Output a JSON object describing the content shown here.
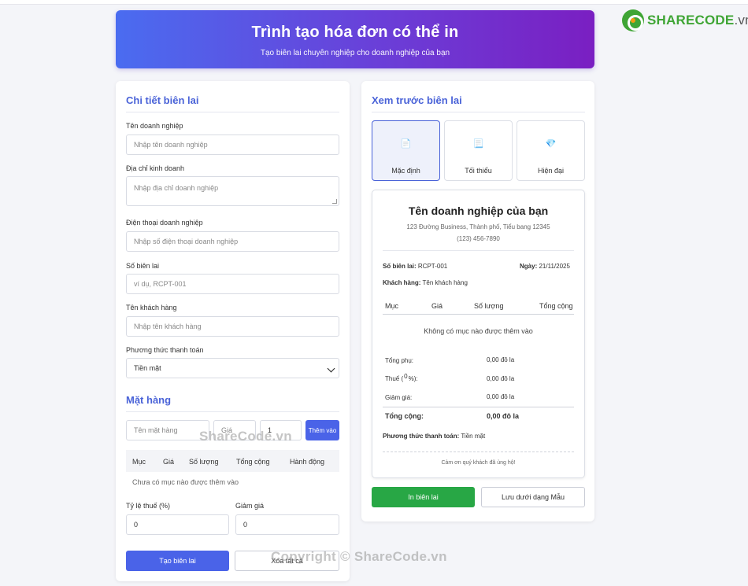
{
  "header": {
    "title": "Trình tạo hóa đơn có thể in",
    "subtitle": "Tạo biên lai chuyên nghiệp cho doanh nghiệp của bạn"
  },
  "logo": {
    "brand": "SHARECODE",
    "domain": ".vn"
  },
  "form": {
    "section_title": "Chi tiết biên lai",
    "business_name": {
      "label": "Tên doanh nghiệp",
      "placeholder": "Nhập tên doanh nghiệp"
    },
    "business_address": {
      "label": "Địa chỉ kinh doanh",
      "placeholder": "Nhập địa chỉ doanh nghiệp"
    },
    "business_phone": {
      "label": "Điện thoại doanh nghiệp",
      "placeholder": "Nhập số điện thoại doanh nghiệp"
    },
    "receipt_number": {
      "label": "Số biên lai",
      "placeholder": "ví dụ, RCPT-001"
    },
    "customer_name": {
      "label": "Tên khách hàng",
      "placeholder": "Nhập tên khách hàng"
    },
    "payment_method": {
      "label": "Phương thức thanh toán",
      "value": "Tiền mặt"
    }
  },
  "items": {
    "section_title": "Mặt hàng",
    "item_placeholder": "Tên mặt hàng",
    "price_placeholder": "Giá",
    "qty_value": "1",
    "add_button": "Thêm vào",
    "columns": [
      "Mục",
      "Giá",
      "Số lượng",
      "Tổng cộng",
      "Hành động"
    ],
    "empty_text": "Chưa có mục nào được thêm vào",
    "tax_label": "Tỷ lệ thuế (%)",
    "tax_value": "0",
    "discount_label": "Giảm giá",
    "discount_value": "0",
    "create_button": "Tạo biên lai",
    "clear_button": "Xóa tất cả"
  },
  "preview": {
    "section_title": "Xem trước biên lai",
    "templates": [
      {
        "label": "Mặc định",
        "icon": "📄"
      },
      {
        "label": "Tối thiểu",
        "icon": "📃"
      },
      {
        "label": "Hiện đại",
        "icon": "💎"
      }
    ],
    "receipt": {
      "business_name": "Tên doanh nghiệp của bạn",
      "address": "123 Đường Business, Thành phố, Tiểu bang 12345",
      "phone": "(123) 456-7890",
      "receipt_no_label": "Số biên lai:",
      "receipt_no": "RCPT-001",
      "date_label": "Ngày:",
      "date": "21/11/2025",
      "customer_label": "Khách hàng:",
      "customer": "Tên khách hàng",
      "columns": [
        "Mục",
        "Giá",
        "Số lượng",
        "Tổng cộng"
      ],
      "empty_text": "Không có mục nào được thêm vào",
      "subtotal_label": "Tổng phụ:",
      "subtotal": "0,00",
      "tax_label_pre": "Thuế (",
      "tax_rate": "0",
      "tax_label_post": "%):",
      "tax": "0,00",
      "discount_label": "Giảm giá:",
      "discount": "0,00",
      "total_label": "Tổng cộng:",
      "total": "0,00 đô la",
      "currency": "đô la",
      "payment_label": "Phương thức thanh toán:",
      "payment": "Tiền mặt",
      "thanks": "Cảm ơn quý khách đã ủng hộ!"
    },
    "print_button": "In biên lai",
    "save_button": "Lưu dưới dạng Mẫu"
  },
  "watermarks": [
    "ShareCode.vn",
    "Copyright © ShareCode.vn"
  ]
}
